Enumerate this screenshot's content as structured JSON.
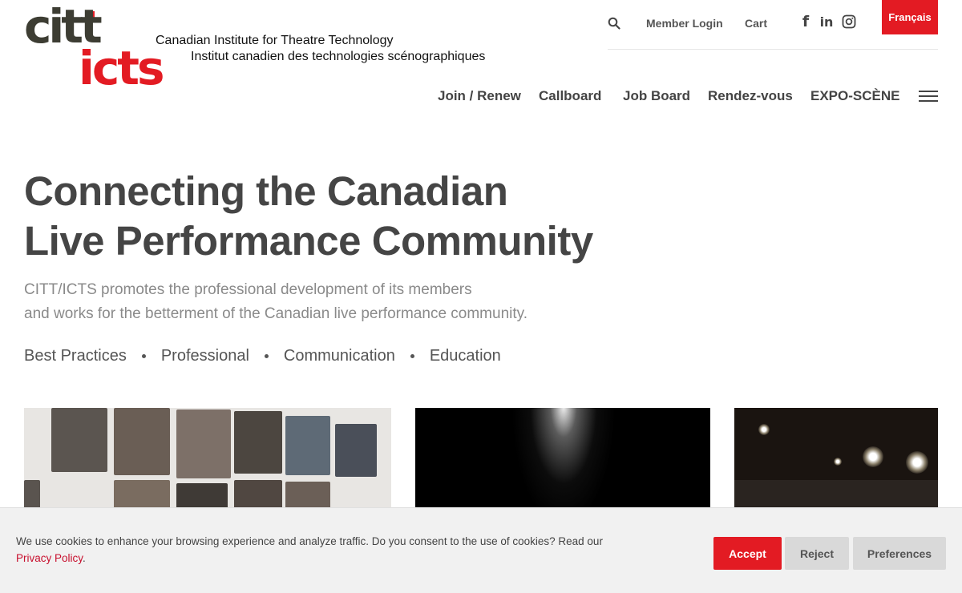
{
  "brand": {
    "logo_top": "citt",
    "logo_bottom": "icts",
    "tagline_en": "Canadian Institute for Theatre Technology",
    "tagline_fr": "Institut canadien des technologies scénographiques",
    "red": "#e31b23",
    "dark": "#3d3d33"
  },
  "utility": {
    "member_login": "Member Login",
    "cart": "Cart",
    "language": "Français"
  },
  "nav": [
    "Join / Renew",
    "Callboard",
    "Job Board",
    "Rendez-vous",
    "EXPO-SCÈNE"
  ],
  "hero": {
    "title_line1": "Connecting the Canadian",
    "title_line2": "Live Performance Community",
    "sub_line1": "CITT/ICTS promotes the professional development of its members",
    "sub_line2": "and works for the betterment of the Canadian live performance community.",
    "pillars": [
      "Best Practices",
      "Professional",
      "Communication",
      "Education"
    ]
  },
  "cookie": {
    "text": "We use cookies to enhance your browsing experience and analyze traffic. Do you consent to the use of cookies? Read our ",
    "link": "Privacy Policy",
    "after": ".",
    "accept": "Accept",
    "reject": "Reject",
    "preferences": "Preferences"
  }
}
